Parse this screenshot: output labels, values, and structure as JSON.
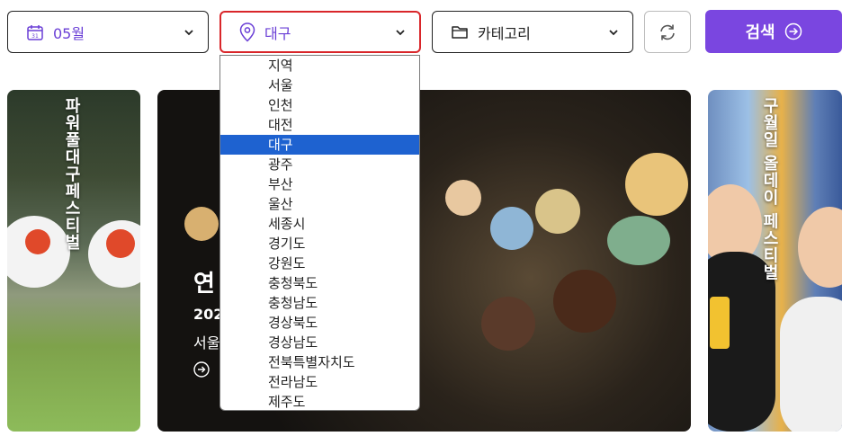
{
  "filters": {
    "date": {
      "label": "05월",
      "icon": "calendar-icon"
    },
    "region": {
      "label": "대구",
      "icon": "location-pin-icon"
    },
    "category": {
      "label": "카테고리",
      "icon": "folder-icon"
    }
  },
  "refresh": {
    "icon": "refresh-icon"
  },
  "search": {
    "label": "검색",
    "icon": "arrow-circle-right-icon"
  },
  "region_options": [
    "지역",
    "서울",
    "인천",
    "대전",
    "대구",
    "광주",
    "부산",
    "울산",
    "세종시",
    "경기도",
    "강원도",
    "충청북도",
    "충청남도",
    "경상북도",
    "경상남도",
    "전북특별자치도",
    "전라남도",
    "제주도"
  ],
  "region_selected": "대구",
  "cards": {
    "left": {
      "title": "파워풀대구페스티벌"
    },
    "center": {
      "title": "연",
      "date": "202",
      "location": "서울"
    },
    "right": {
      "title": "구월일 올데이 페스티벌"
    }
  },
  "colors": {
    "accent": "#7a46e0",
    "focus_border": "#d9262a",
    "highlight": "#1e62d0"
  }
}
